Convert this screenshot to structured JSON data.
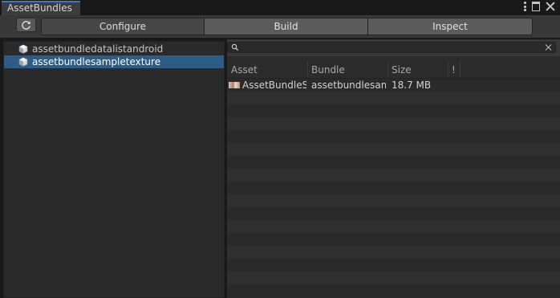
{
  "window": {
    "tab_title": "AssetBundles"
  },
  "toolbar": {
    "refresh_icon": "refresh-icon",
    "segments": [
      "Configure",
      "Build",
      "Inspect"
    ],
    "active_segment": "Configure"
  },
  "bundle_list": {
    "items": [
      {
        "label": "assetbundledatalistandroid",
        "selected": false
      },
      {
        "label": "assetbundlesampletexture",
        "selected": true
      }
    ]
  },
  "search": {
    "value": "",
    "placeholder": ""
  },
  "asset_table": {
    "columns": [
      "Asset",
      "Bundle",
      "Size",
      "!"
    ],
    "rows": [
      {
        "asset": "AssetBundleSa",
        "bundle": "assetbundlesam",
        "size": "18.7 MB",
        "warning": ""
      }
    ]
  },
  "colors": {
    "accent": "#3a79bb",
    "selection": "#2c5d87",
    "background": "#191919"
  }
}
